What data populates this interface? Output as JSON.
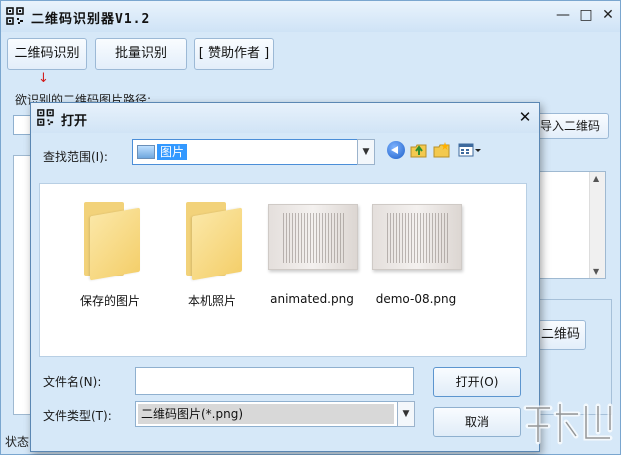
{
  "main_window": {
    "title": "二维码识别器V1.2",
    "buttons": [
      "二维码识别",
      "批量识别",
      "[ 赞助作者 ]"
    ],
    "arrow_glyph": "↓",
    "path_label": "欲识别的二维码图片路径:",
    "import_label": "导入二维码",
    "generate_label": "二维码",
    "status_label": "状态:",
    "window_controls": {
      "minimize": "—",
      "maximize": "□",
      "close": "✕"
    }
  },
  "dialog": {
    "title": "打开",
    "close_glyph": "✕",
    "look_in_label": "查找范围(I):",
    "look_in_value": "图片",
    "files": [
      {
        "name": "保存的图片",
        "kind": "folder"
      },
      {
        "name": "本机照片",
        "kind": "folder"
      },
      {
        "name": "animated.png",
        "kind": "image"
      },
      {
        "name": "demo-08.png",
        "kind": "image"
      }
    ],
    "file_name_label": "文件名(N):",
    "file_name_value": "",
    "file_type_label": "文件类型(T):",
    "file_type_value": "二维码图片(*.png)",
    "open_button": "打开(O)",
    "cancel_button": "取消"
  },
  "colors": {
    "accent": "#3399ff",
    "arrow": "#d21d1d",
    "window_bg": "#d6e8f8"
  },
  "icons": [
    "qr-app-icon",
    "back-icon",
    "up-folder-icon",
    "new-folder-icon",
    "view-menu-icon",
    "folder-icon",
    "image-thumbnail-icon"
  ]
}
